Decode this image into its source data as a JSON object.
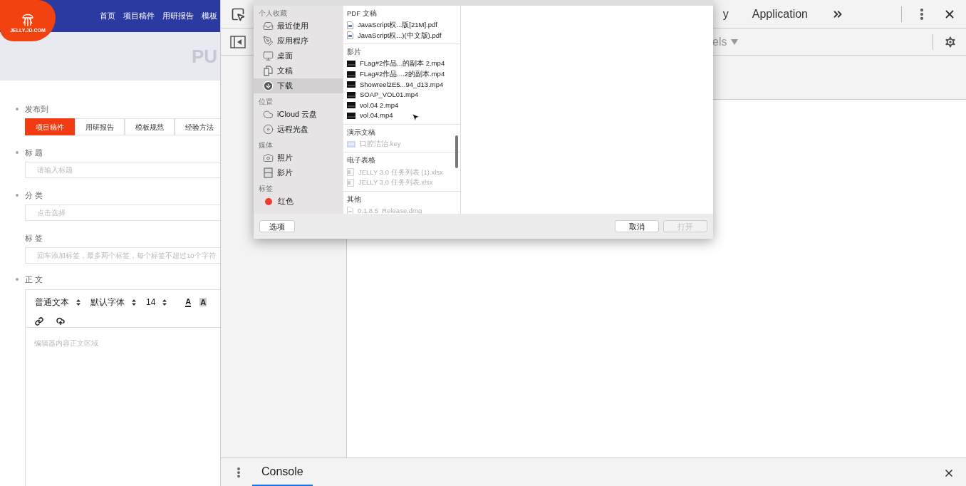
{
  "page": {
    "logo": "JELLY.JD.COM",
    "nav": [
      {
        "label": "首页"
      },
      {
        "label": "项目稿件"
      },
      {
        "label": "用研报告"
      },
      {
        "label": "模板"
      }
    ],
    "banner_text": "PU",
    "publish_to": {
      "label": "发布到",
      "required": true,
      "options": [
        {
          "label": "项目稿件",
          "selected": true
        },
        {
          "label": "用研报告",
          "selected": false
        },
        {
          "label": "模板规范",
          "selected": false
        },
        {
          "label": "经验方法",
          "selected": false
        }
      ]
    },
    "fields": [
      {
        "label": "标 题",
        "required": true,
        "placeholder": "请输入标题"
      },
      {
        "label": "分 类",
        "required": true,
        "placeholder": "点击选择"
      },
      {
        "label": "标 签",
        "required": false,
        "placeholder": "回车添加标签，最多两个标签，每个标签不超过10个字符"
      }
    ],
    "editor": {
      "label": "正 文",
      "required": true,
      "toolbar": [
        {
          "kind": "select",
          "label": "普通文本"
        },
        {
          "kind": "select",
          "label": "默认字体"
        },
        {
          "kind": "select",
          "label": "14"
        },
        {
          "kind": "color",
          "label": "A"
        },
        {
          "kind": "highlight",
          "label": "A"
        },
        {
          "kind": "link"
        },
        {
          "kind": "upload"
        }
      ],
      "placeholder": "编辑器内容正文区域"
    }
  },
  "devtools": {
    "tabs": [
      {
        "label": "y",
        "selected": false
      },
      {
        "label": "Application",
        "selected": false
      }
    ],
    "filter": "els",
    "drawer_tabs": [
      {
        "label": "Console",
        "selected": true
      }
    ]
  },
  "dialog": {
    "sidebar": [
      {
        "heading": "个人收藏",
        "items": [
          {
            "kind": "recent",
            "label": "最近使用",
            "selected": false
          },
          {
            "kind": "apps",
            "label": "应用程序",
            "selected": false
          },
          {
            "kind": "desktop",
            "label": "桌面",
            "selected": false
          },
          {
            "kind": "documents",
            "label": "文稿",
            "selected": false
          },
          {
            "kind": "downloads",
            "label": "下载",
            "selected": true
          }
        ]
      },
      {
        "heading": "位置",
        "items": [
          {
            "kind": "cloud",
            "label": "iCloud 云盘",
            "selected": false
          },
          {
            "kind": "disc",
            "label": "远程光盘",
            "selected": false
          }
        ]
      },
      {
        "heading": "媒体",
        "items": [
          {
            "kind": "photos",
            "label": "照片",
            "selected": false
          },
          {
            "kind": "movies",
            "label": "影片",
            "selected": false
          }
        ]
      },
      {
        "heading": "标签",
        "items": [
          {
            "kind": "tag",
            "label": "红色",
            "selected": false,
            "color": "#f03a30"
          }
        ]
      }
    ],
    "groups": [
      {
        "heading": "PDF 文稿",
        "files": [
          {
            "kind": "pdf",
            "name": "JavaScript权...版[21M].pdf",
            "disabled": false
          },
          {
            "kind": "pdf",
            "name": "JavaScript权...)(中文版).pdf",
            "disabled": false
          }
        ]
      },
      {
        "heading": "影片",
        "files": [
          {
            "kind": "video",
            "name": "FLag#2作品...的副本 2.mp4",
            "disabled": false
          },
          {
            "kind": "video",
            "name": "FLag#2作品....2的副本.mp4",
            "disabled": false
          },
          {
            "kind": "video",
            "name": "Showreel2E5...94_d13.mp4",
            "disabled": false
          },
          {
            "kind": "video",
            "name": "SOAP_VOL01.mp4",
            "disabled": false
          },
          {
            "kind": "video",
            "name": "vol.04 2.mp4",
            "disabled": false
          },
          {
            "kind": "video",
            "name": "vol.04.mp4",
            "disabled": false
          }
        ]
      },
      {
        "heading": "演示文稿",
        "files": [
          {
            "kind": "key",
            "name": "口腔洁治.key",
            "disabled": true
          }
        ]
      },
      {
        "heading": "电子表格",
        "files": [
          {
            "kind": "sheet",
            "name": "JELLY 3.0 任务列表 (1).xlsx",
            "disabled": true
          },
          {
            "kind": "sheet",
            "name": "JELLY 3.0 任务列表.xlsx",
            "disabled": true
          }
        ]
      },
      {
        "heading": "其他",
        "files": [
          {
            "kind": "file",
            "name": "0.1.8.5_Release.dmg",
            "disabled": true
          }
        ]
      }
    ],
    "buttons": [
      {
        "label": "选项",
        "disabled": false
      },
      {
        "label": "取消",
        "disabled": false
      },
      {
        "label": "打开",
        "disabled": true
      }
    ]
  }
}
